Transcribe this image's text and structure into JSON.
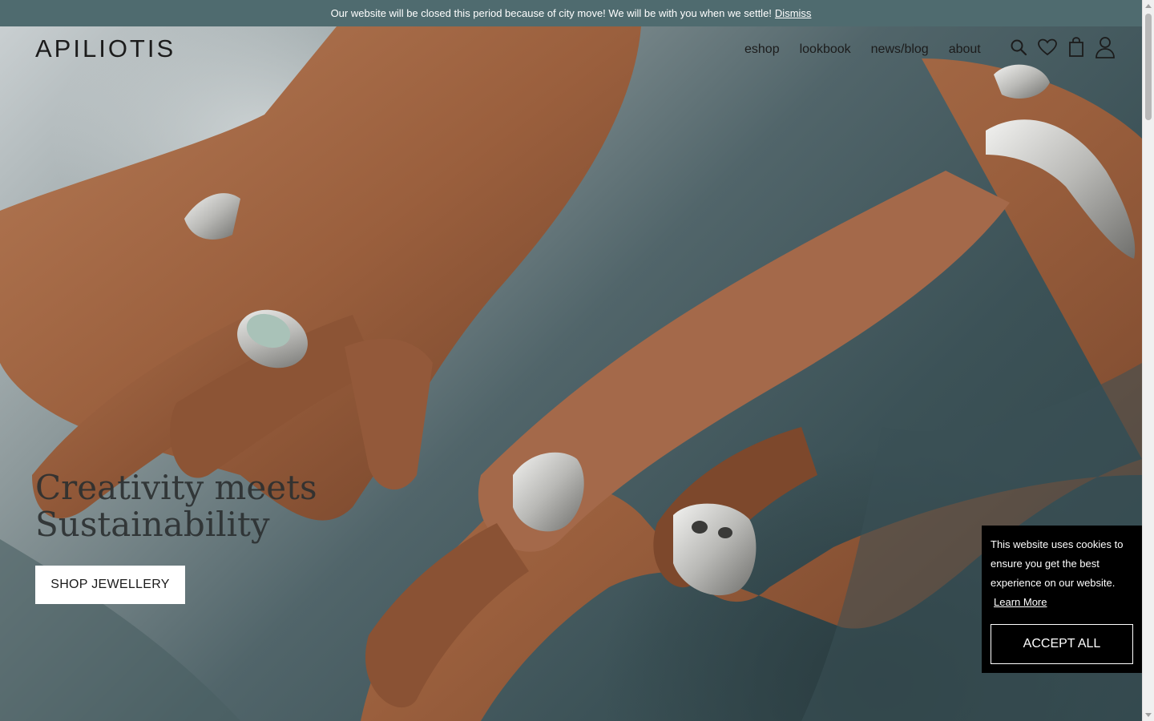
{
  "announcement": {
    "text": "Our website will be closed this period because of city move! We will be with you when we settle!",
    "dismiss_label": "Dismiss"
  },
  "header": {
    "logo": "APILIOTIS",
    "nav": [
      {
        "label": "eshop"
      },
      {
        "label": "lookbook"
      },
      {
        "label": "news/blog"
      },
      {
        "label": "about"
      }
    ],
    "icons": [
      "search-icon",
      "heart-icon",
      "shopping-bag-icon",
      "user-icon"
    ]
  },
  "hero": {
    "title_line1": "Creativity meets",
    "title_line2": "Sustainability",
    "cta_label": "SHOP JEWELLERY"
  },
  "cookie": {
    "text": "This website uses cookies to ensure you get the best experience on our website.",
    "learn_more": "Learn More",
    "accept_label": "ACCEPT ALL"
  },
  "colors": {
    "announcement_bg": "#4f6b6f",
    "cookie_bg": "#000000",
    "cta_bg": "#ffffff"
  }
}
